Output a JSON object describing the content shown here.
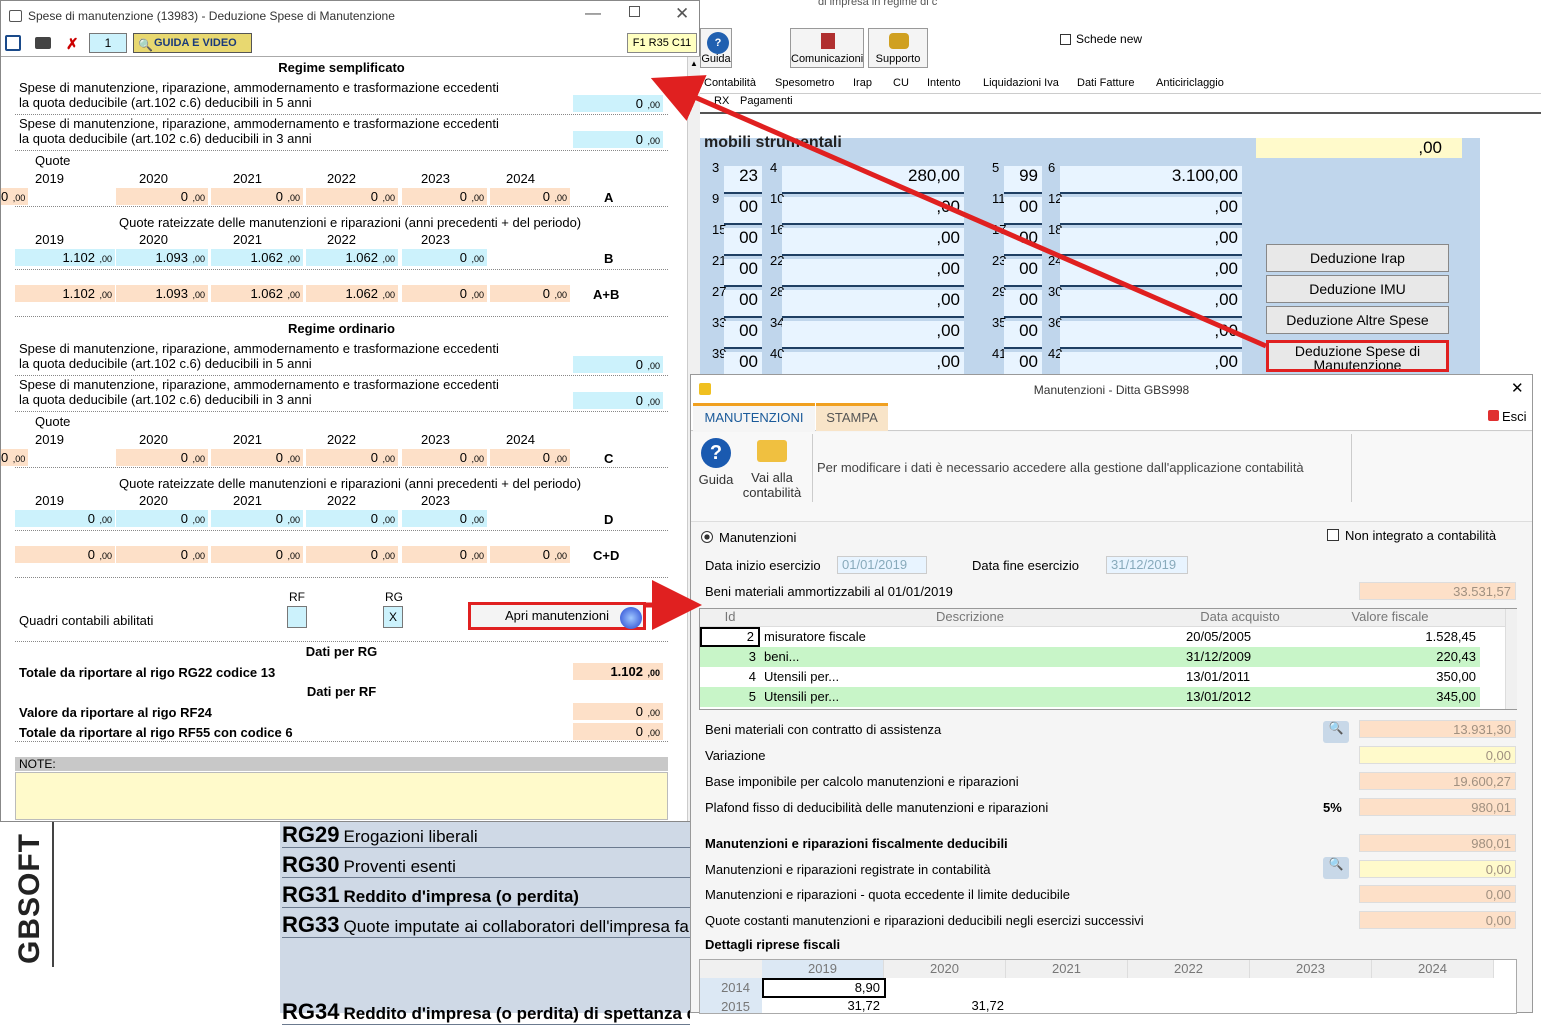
{
  "bg": {
    "title_frag": "di impresa in regime di c",
    "schede_new": "Schede new",
    "tools": [
      "Guida",
      "Comunicazioni",
      "Supporto"
    ],
    "menu": [
      "Contabilità",
      "Spesometro",
      "Irap",
      "CU",
      "Intento",
      "Liquidazioni Iva",
      "Dati Fatture",
      "Anticiriclaggio"
    ],
    "menu2": [
      "RX",
      "Pagamenti"
    ],
    "form_title": "mobili strumentali",
    "form_top_value": ",00",
    "cells": [
      {
        "n": "3",
        "v": "23"
      },
      {
        "n": "4",
        "v": "280,00"
      },
      {
        "n": "5",
        "v": "99"
      },
      {
        "n": "6",
        "v": "3.100,00"
      },
      {
        "n": "9"
      },
      {
        "n": "10"
      },
      {
        "n": "11"
      },
      {
        "n": "12"
      },
      {
        "n": "15"
      },
      {
        "n": "16"
      },
      {
        "n": "17"
      },
      {
        "n": "18"
      },
      {
        "n": "21"
      },
      {
        "n": "22"
      },
      {
        "n": "23"
      },
      {
        "n": "24"
      },
      {
        "n": "27"
      },
      {
        "n": "28"
      },
      {
        "n": "29"
      },
      {
        "n": "30"
      },
      {
        "n": "33"
      },
      {
        "n": "34"
      },
      {
        "n": "35"
      },
      {
        "n": "36"
      },
      {
        "n": "39"
      },
      {
        "n": "40"
      },
      {
        "n": "41"
      },
      {
        "n": "42"
      }
    ],
    "zero": ",00",
    "zero00": "00",
    "buttons": [
      "Deduzione Irap",
      "Deduzione IMU",
      "Deduzione Altre Spese",
      "Deduzione Spese di Manutenzione"
    ],
    "rg": [
      {
        "code": "RG29",
        "text": "Erogazioni liberali"
      },
      {
        "code": "RG30",
        "text": "Proventi esenti"
      },
      {
        "code": "RG31",
        "text": "Reddito d'impresa (o perdita)"
      },
      {
        "code": "RG33",
        "text": "Quote imputate ai collaboratori dell'impresa fa"
      },
      {
        "code": "RG34",
        "text": "Reddito d'impresa (o perdita) di spettanza dell"
      }
    ],
    "logo": "GBSOFT"
  },
  "win1": {
    "title": "Spese di manutenzione (13983) - Deduzione Spese di Manutenzione",
    "page": "1",
    "guida": "GUIDA E VIDEO",
    "pos": "F1 R35 C11",
    "semplificato": "Regime semplificato",
    "ordinario": "Regime ordinario",
    "spese5a": "Spese di manutenzione, riparazione, ammodernamento e trasformazione eccedenti",
    "spese5b": "la quota deducibile (art.102 c.6) deducibili in 5 anni",
    "spese3b": "la quota deducibile (art.102 c.6) deducibili in 3 anni",
    "quote": "Quote",
    "rateizzate": "Quote rateizzate delle manutenzioni e riparazioni (anni precedenti + del periodo)",
    "years6": [
      "2019",
      "2020",
      "2021",
      "2022",
      "2023",
      "2024"
    ],
    "years5": [
      "2019",
      "2020",
      "2021",
      "2022",
      "2023"
    ],
    "rowA": [
      "0",
      "0",
      "0",
      "0",
      "0",
      "0"
    ],
    "rowB": [
      "1.102",
      "1.093",
      "1.062",
      "1.062",
      "0"
    ],
    "rowAB": [
      "1.102",
      "1.093",
      "1.062",
      "1.062",
      "0",
      "0"
    ],
    "rowC": [
      "0",
      "0",
      "0",
      "0",
      "0",
      "0"
    ],
    "rowD": [
      "0",
      "0",
      "0",
      "0",
      "0"
    ],
    "rowCD": [
      "0",
      "0",
      "0",
      "0",
      "0",
      "0"
    ],
    "letters": {
      "a": "A",
      "b": "B",
      "ab": "A+B",
      "c": "C",
      "d": "D",
      "cd": "C+D"
    },
    "s5": "0",
    "s3": "0",
    "o5": "0",
    "o3": "0",
    "quadri": "Quadri contabili abilitati",
    "rf": "RF",
    "rg": "RG",
    "rg_check": "X",
    "apri": "Apri manutenzioni",
    "datirg": "Dati per RG",
    "tot_rg": "Totale da riportare al rigo RG22 codice 13",
    "tot_rg_v": "1.102",
    "datirf": "Dati per RF",
    "val_rf": "Valore da riportare al rigo RF24",
    "val_rf_v": "0",
    "tot_rf": "Totale da riportare al rigo RF55 con codice 6",
    "tot_rf_v": "0",
    "note": "NOTE:"
  },
  "win2": {
    "title": "Manutenzioni - Ditta GBS998",
    "tab1": "MANUTENZIONI",
    "tab2": "STAMPA",
    "esci": "Esci",
    "guida": "Guida",
    "vai": "Vai alla contabilità",
    "info": "Per modificare i dati è necessario accedere alla gestione dall'applicazione contabilità",
    "radio": "Manutenzioni",
    "nonint": "Non integrato a contabilità",
    "dinizio": "Data inizio esercizio",
    "dinizio_v": "01/01/2019",
    "dfine": "Data fine esercizio",
    "dfine_v": "31/12/2019",
    "beni": "Beni materiali ammortizzabili al 01/01/2019",
    "beni_v": "33.531,57",
    "cols": [
      "Id",
      "Descrizione",
      "Data acquisto",
      "Valore fiscale"
    ],
    "rows": [
      {
        "id": "2",
        "d": "misuratore fiscale",
        "date": "20/05/2005",
        "v": "1.528,45"
      },
      {
        "id": "3",
        "d": "beni...",
        "date": "31/12/2009",
        "v": "220,43"
      },
      {
        "id": "4",
        "d": "Utensili per...",
        "date": "13/01/2011",
        "v": "350,00"
      },
      {
        "id": "5",
        "d": "Utensili per...",
        "date": "13/01/2012",
        "v": "345,00"
      }
    ],
    "l1": "Beni materiali con contratto di assistenza",
    "v1": "13.931,30",
    "l2": "Variazione",
    "v2": "0,00",
    "l3": "Base imponibile per calcolo manutenzioni e riparazioni",
    "v3": "19.600,27",
    "l4": "Plafond fisso di deducibilità delle manutenzioni e riparazioni",
    "pct": "5%",
    "v4": "980,01",
    "l5": "Manutenzioni e riparazioni fiscalmente deducibili",
    "v5": "980,01",
    "l6": "Manutenzioni e riparazioni registrate in contabilità",
    "v6": "0,00",
    "l7": "Manutenzioni e riparazioni - quota eccedente il limite deducibile",
    "v7": "0,00",
    "l8": "Quote costanti manutenzioni e riparazioni deducibili negli esercizi successivi",
    "v8": "0,00",
    "dett": "Dettagli riprese fiscali",
    "gyears": [
      "2019",
      "2020",
      "2021",
      "2022",
      "2023",
      "2024"
    ],
    "g1": {
      "y": "2014",
      "v": "8,90"
    },
    "g2": {
      "y": "2015",
      "v1": "31,72",
      "v2": "31,72"
    }
  },
  "colors": {
    "cyan": "#ccf2fc",
    "orange": "#fde0c8",
    "red": "#e02020",
    "green": "#c8f5c8"
  }
}
